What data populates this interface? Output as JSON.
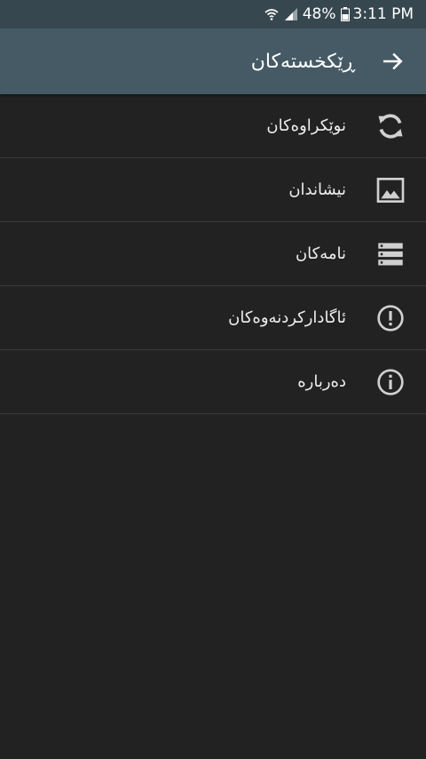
{
  "status": {
    "battery_percent": "48%",
    "time": "3:11 PM",
    "icons": [
      "wifi-icon",
      "signal-icon",
      "battery-icon"
    ]
  },
  "header": {
    "title": "ڕێکخستەکان",
    "back_icon": "arrow-right-icon"
  },
  "menu": {
    "items": [
      {
        "label": "نوێکراوەکان",
        "icon": "refresh-icon"
      },
      {
        "label": "نیشاندان",
        "icon": "image-icon"
      },
      {
        "label": "نامەکان",
        "icon": "list-icon"
      },
      {
        "label": "ئاگادارکردنەوەکان",
        "icon": "alert-icon"
      },
      {
        "label": "دەربارە",
        "icon": "info-icon"
      }
    ]
  },
  "colors": {
    "statusbar": "#37474f",
    "appbar": "#455a64",
    "background": "#222222",
    "divider": "#3a3a3a"
  }
}
